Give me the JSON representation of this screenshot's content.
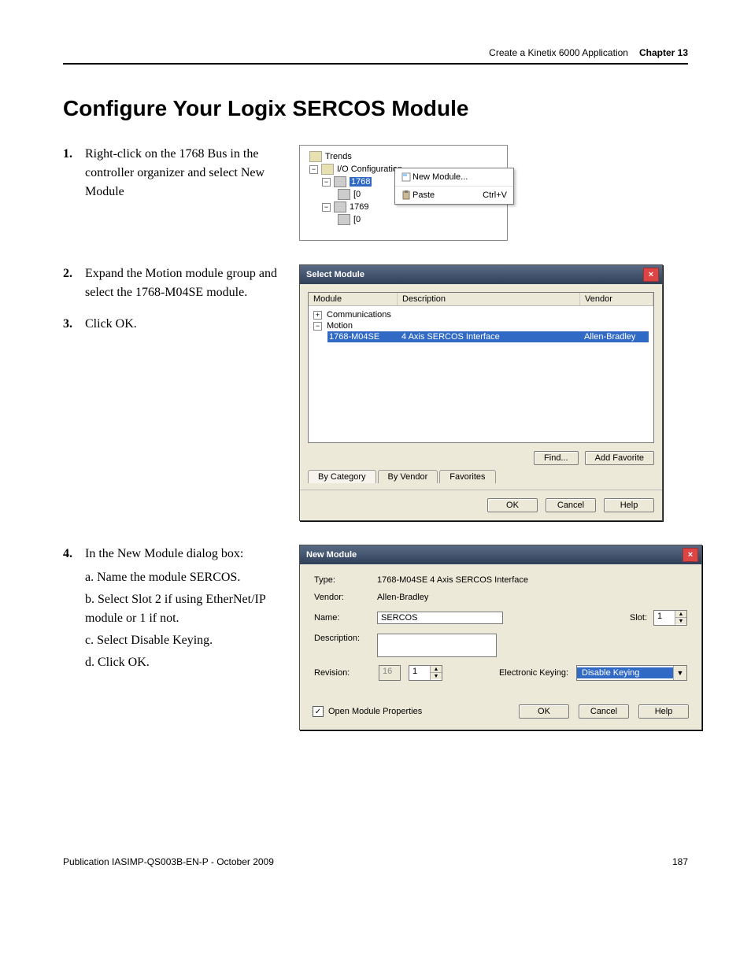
{
  "header": {
    "breadcrumb": "Create a Kinetix 6000 Application",
    "chapter": "Chapter 13"
  },
  "title": "Configure Your Logix SERCOS Module",
  "steps": {
    "s1": {
      "num": "1.",
      "text": "Right-click on the 1768 Bus in the controller organizer and select New Module"
    },
    "s2": {
      "num": "2.",
      "text": "Expand the Motion module group and select the 1768-M04SE module."
    },
    "s3": {
      "num": "3.",
      "text": "Click OK."
    },
    "s4": {
      "num": "4.",
      "text": "In the New Module dialog box:",
      "a": "a. Name the module SERCOS.",
      "b": "b. Select Slot 2 if using EtherNet/IP module or 1 if not.",
      "c": "c. Select Disable Keying.",
      "d": "d. Click OK."
    }
  },
  "tree": {
    "trends": "Trends",
    "io": "I/O Configuration",
    "bus1768": "1768",
    "sub0a": "[0",
    "bus1769": "1769",
    "sub0b": "[0",
    "ctx_new": "New Module...",
    "ctx_paste": "Paste",
    "ctx_paste_accel": "Ctrl+V"
  },
  "select_module": {
    "title": "Select Module",
    "col_module": "Module",
    "col_desc": "Description",
    "col_vendor": "Vendor",
    "group_comm": "Communications",
    "group_motion": "Motion",
    "item_name": "1768-M04SE",
    "item_desc": "4 Axis SERCOS Interface",
    "item_vendor": "Allen-Bradley",
    "find": "Find...",
    "add_fav": "Add Favorite",
    "tab_cat": "By Category",
    "tab_vendor": "By Vendor",
    "tab_fav": "Favorites",
    "ok": "OK",
    "cancel": "Cancel",
    "help": "Help"
  },
  "new_module": {
    "title": "New Module",
    "type_lbl": "Type:",
    "type_val": "1768-M04SE 4 Axis SERCOS Interface",
    "vendor_lbl": "Vendor:",
    "vendor_val": "Allen-Bradley",
    "name_lbl": "Name:",
    "name_val": "SERCOS",
    "slot_lbl": "Slot:",
    "slot_val": "1",
    "desc_lbl": "Description:",
    "rev_lbl": "Revision:",
    "rev_major": "16",
    "rev_minor": "1",
    "ek_lbl": "Electronic Keying:",
    "ek_val": "Disable Keying",
    "open_props": "Open Module Properties",
    "ok": "OK",
    "cancel": "Cancel",
    "help": "Help"
  },
  "footer": {
    "pub": "Publication IASIMP-QS003B-EN-P - October 2009",
    "page": "187"
  }
}
